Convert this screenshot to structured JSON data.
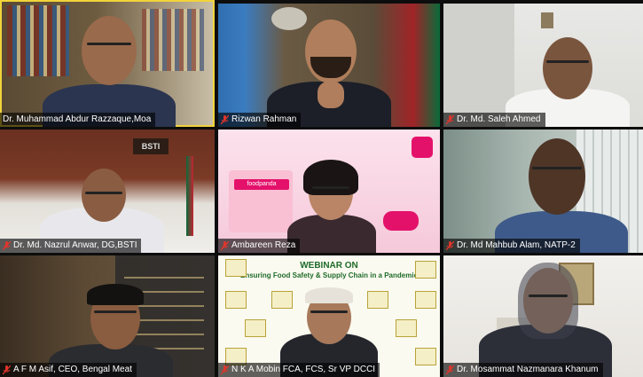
{
  "participants": [
    {
      "name": "Dr. Muhammad Abdur Razzaque,Moa",
      "muted": false,
      "active": true
    },
    {
      "name": "Rizwan Rahman",
      "muted": true,
      "active": false
    },
    {
      "name": "Dr. Md. Saleh Ahmed",
      "muted": true,
      "active": false
    },
    {
      "name": "Dr. Md. Nazrul Anwar, DG,BSTI",
      "muted": true,
      "active": false
    },
    {
      "name": "Ambareen Reza",
      "muted": true,
      "active": false
    },
    {
      "name": "Dr. Md Mahbub Alam, NATP-2",
      "muted": true,
      "active": false
    },
    {
      "name": "A F M Asif, CEO, Bengal Meat",
      "muted": true,
      "active": false
    },
    {
      "name": "N K A Mobin FCA, FCS, Sr VP DCCI",
      "muted": true,
      "active": false
    },
    {
      "name": "Dr. Mosammat Nazmanara Khanum",
      "muted": true,
      "active": false
    }
  ],
  "backgrounds": {
    "bsti_sign": "BSTI",
    "foodpanda_sign": "foodpanda",
    "webinar_title": "WEBINAR ON",
    "webinar_subtitle": "Ensuring Food Safety & Supply Chain in a Pandemic"
  },
  "colors": {
    "active_border": "#f2d33a",
    "muted_mic": "#e0352b",
    "unmuted_mic": "#ffffff",
    "foodpanda_pink": "#e4116b"
  }
}
